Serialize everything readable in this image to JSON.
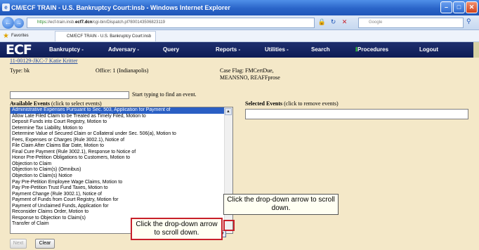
{
  "window": {
    "title": "CM/ECF TRAIN - U.S. Bankruptcy Court:insb - Windows Internet Explorer",
    "controls": [
      "minimize-icon",
      "maximize-icon",
      "close-icon"
    ]
  },
  "address_bar": {
    "url_scheme": "https",
    "url_host": "ecf7.dcn",
    "url_prefix": "://ecf-train.insb.",
    "url_rest": "/cgi-bin/Dispatch.pl?800143506823119",
    "search_placeholder": "Google"
  },
  "favorites_bar": {
    "label": "Favorites",
    "tab": "CM/ECF TRAIN - U.S. Bankruptcy Court:insb"
  },
  "ecf_menu": {
    "logo": "ECF",
    "items": [
      "Bankruptcy -",
      "Adversary -",
      "Query",
      "Reports -",
      "Utilities -",
      "Search",
      "Procedures",
      "Logout"
    ]
  },
  "case_info": {
    "case_link": "11-00129-JKC-7 Katie Kritter",
    "type": "Type: bk",
    "office": "Office: 1 (Indianapolis)",
    "case_flag_line1": "Case Flag: FMCertDue,",
    "case_flag_line2": "MEANSNO, REAFFprose"
  },
  "find": {
    "hint": "Start typing to find an event."
  },
  "available_events": {
    "header_bold": "Available Events",
    "header_note": " (click to select events)",
    "items": [
      "Administrative Expenses Pursuant to Sec. 503, Application for Payment of",
      "Allow Late Filed Claim to be Treated as Timely Filed, Motion to",
      "Deposit Funds into Court Registry, Motion to",
      "Determine Tax Liability, Motion to",
      "Determine Value of Secured Claim or Collateral under Sec. 506(a), Motion to",
      "Fees, Expenses or Charges (Rule 3002.1), Notice of",
      "File Claim After Claims Bar Date, Motion to",
      "Final Cure Payment (Rule 3002.1), Response to Notice of",
      "Honor Pre-Petition Obligations to Customers, Motion to",
      "Objection to Claim",
      "Objection to Claim(s) (Omnibus)",
      "Objection to Claim(s) Notice",
      "Pay Pre-Petition Employee Wage Claims, Motion to",
      "Pay Pre-Petition Trust Fund Taxes, Motion to",
      "Payment Change (Rule 3002.1), Notice of",
      "Payment of Funds from Court Registry, Motion for",
      "Payment of Unclaimed Funds, Application for",
      "Reconsider Claims Order, Motion to",
      "Response to Objection to Claim(s)",
      "Transfer of Claim"
    ],
    "selected_index": 0
  },
  "selected_events": {
    "header_bold": "Selected Events",
    "header_note": " (click to remove events)"
  },
  "buttons": {
    "next": "Next",
    "clear": "Clear"
  },
  "callouts": {
    "top": "Click the drop-down arrow to scroll down.",
    "bottom": "Click the drop-down arrow to scroll down."
  },
  "colors": {
    "menu_bg": "#0e1c55",
    "page_bg": "#f4e8c8",
    "selection": "#2a5fc4",
    "callout_border": "#c8202a"
  }
}
